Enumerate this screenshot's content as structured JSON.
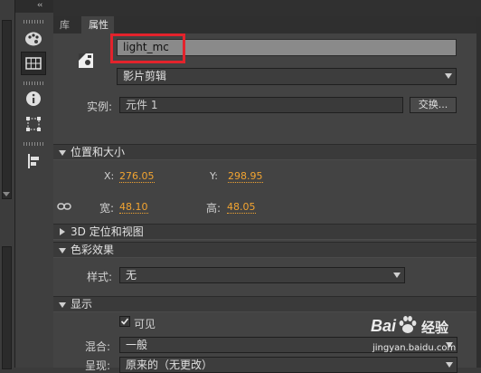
{
  "panel": {
    "collapse_glyph": "‹‹",
    "tabs": [
      {
        "label": "库",
        "active": false
      },
      {
        "label": "属性",
        "active": true
      }
    ]
  },
  "toolbar": {
    "icons": [
      "palette-icon",
      "grid-icon",
      "info-icon",
      "transform-icon",
      "align-icon"
    ]
  },
  "instance": {
    "name_value": "light_mc",
    "type_value": "影片剪辑",
    "instance_label": "实例:",
    "instance_value": "元件 1",
    "swap_button": "交换..."
  },
  "position_size": {
    "header": "位置和大小",
    "x_label": "X:",
    "x_value": "276.05",
    "y_label": "Y:",
    "y_value": "298.95",
    "w_label": "宽:",
    "w_value": "48.10",
    "h_label": "高:",
    "h_value": "48.05"
  },
  "view3d": {
    "header": "3D 定位和视图"
  },
  "color_effect": {
    "header": "色彩效果",
    "style_label": "样式:",
    "style_value": "无"
  },
  "display": {
    "header": "显示",
    "visible_label": "可见",
    "visible_checked": true,
    "blend_label": "混合:",
    "blend_value": "一般",
    "render_label": "呈现:",
    "render_value": "原来的（无更改）"
  },
  "watermark": {
    "brand": "Bai",
    "brand_suffix": "经验",
    "url": "jingyan.baidu.com"
  },
  "colors": {
    "accent_value": "#f2a431",
    "highlight": "#e3232c"
  }
}
